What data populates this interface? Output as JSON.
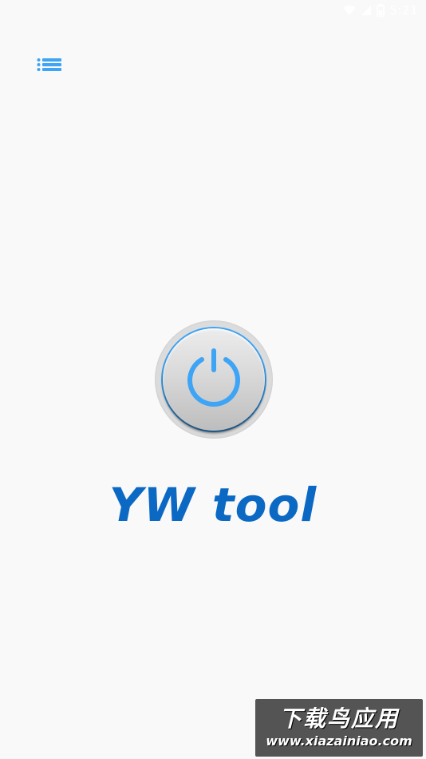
{
  "status_bar": {
    "time": "5:21",
    "icons": [
      "wifi-icon",
      "cell-signal-icon",
      "battery-icon"
    ]
  },
  "toolbar": {
    "menu_icon": "list-menu-icon"
  },
  "power": {
    "icon": "power-icon",
    "accent_color": "#3ea4f5"
  },
  "app": {
    "title": "YW tool",
    "title_color": "#0b69c4"
  },
  "watermark": {
    "line1": "下载鸟应用",
    "line2": "www.xiazainiao.com"
  }
}
